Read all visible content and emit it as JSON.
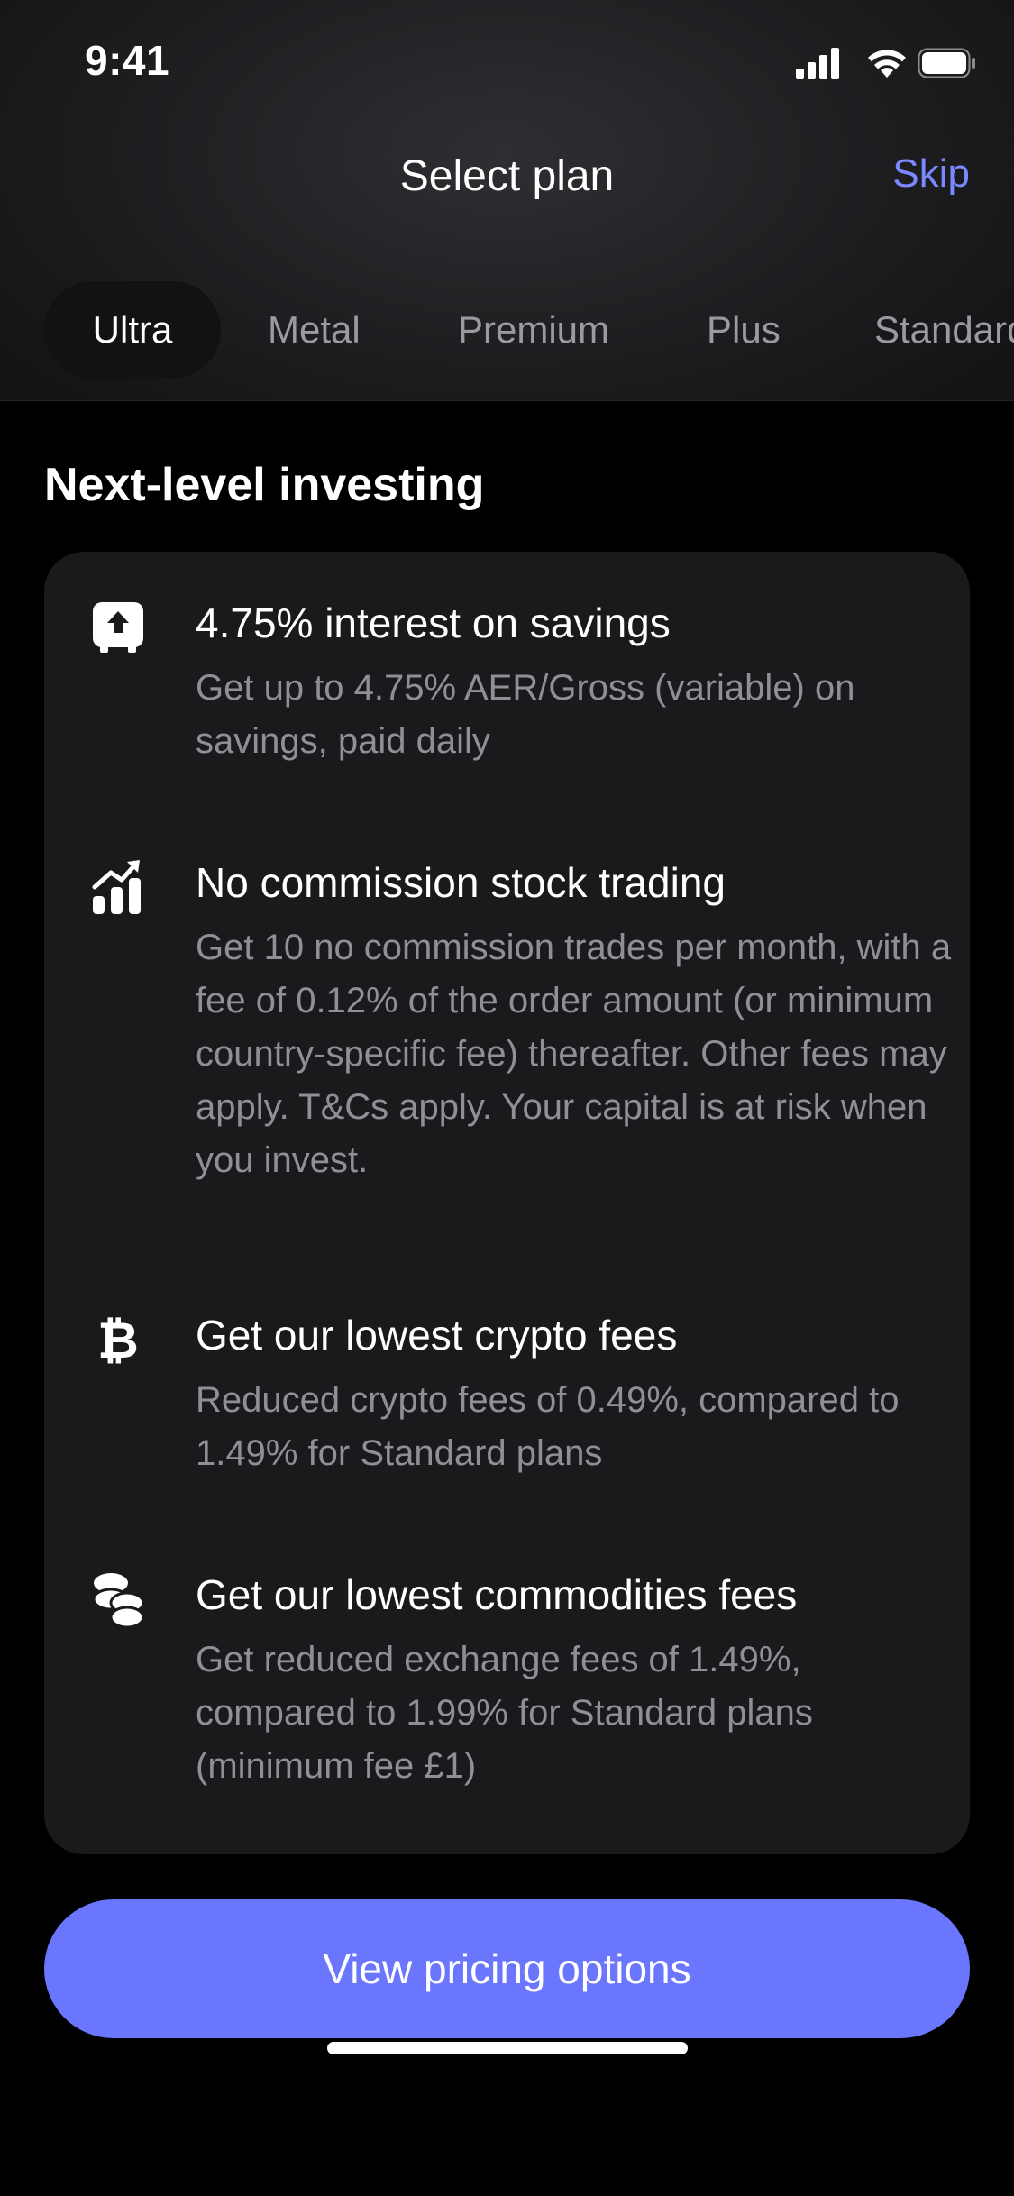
{
  "status_bar": {
    "time": "9:41",
    "icons": [
      "cellular-signal-icon",
      "wifi-icon",
      "battery-icon"
    ]
  },
  "nav": {
    "title": "Select plan",
    "skip_label": "Skip"
  },
  "plan_tabs": [
    {
      "label": "Ultra",
      "selected": true
    },
    {
      "label": "Metal",
      "selected": false
    },
    {
      "label": "Premium",
      "selected": false
    },
    {
      "label": "Plus",
      "selected": false
    },
    {
      "label": "Standard",
      "selected": false
    }
  ],
  "section": {
    "title": "Next-level investing"
  },
  "features": [
    {
      "icon": "savings-jar-icon",
      "title": "4.75% interest on savings",
      "description": "Get up to 4.75% AER/Gross (variable) on savings, paid daily"
    },
    {
      "icon": "stock-chart-icon",
      "title": "No commission stock trading",
      "description": "Get 10 no commission trades per month, with a fee of 0.12% of the order amount (or minimum country-specific fee) thereafter. Other fees may apply. T&Cs apply. Your capital is at risk when you invest."
    },
    {
      "icon": "bitcoin-icon",
      "title": "Get our lowest crypto fees",
      "description": "Reduced crypto fees of 0.49%, compared to 1.49% for Standard plans"
    },
    {
      "icon": "coins-icon",
      "title": "Get our lowest commodities fees",
      "description": "Get reduced exchange fees of 1.49%, compared to 1.99% for Standard plans (minimum fee £1)"
    }
  ],
  "cta": {
    "label": "View pricing options"
  },
  "colors": {
    "accent": "#6b76ff",
    "link": "#7b88ff",
    "card_bg": "#1a1a1d",
    "muted_text": "#8f8f95"
  }
}
